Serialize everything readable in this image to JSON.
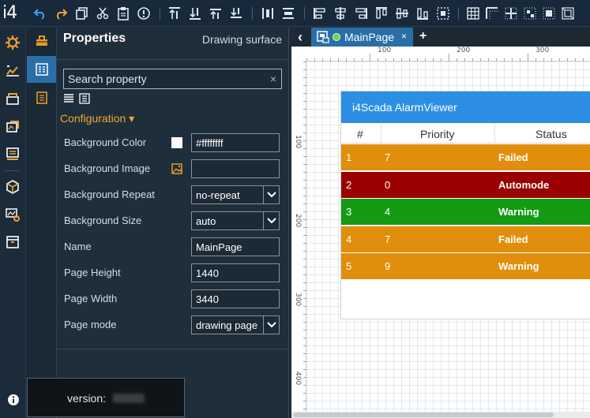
{
  "app": {
    "logo": "i4"
  },
  "toolbar": {
    "icons": [
      "undo-icon",
      "redo-icon",
      "copy-icon",
      "cut-icon",
      "paste-icon",
      "info-icon",
      "bring-front-icon",
      "send-back-icon",
      "bring-forward-icon",
      "send-backward-icon",
      "distribute-horizontal-icon",
      "distribute-vertical-icon",
      "align-left-icon",
      "align-center-icon",
      "align-right-icon",
      "align-top-icon",
      "align-middle-icon",
      "align-bottom-icon",
      "group-icon",
      "grid-icon",
      "grid-corner-icon",
      "grid-center-icon",
      "grid-dots-icon",
      "grid-fill-icon",
      "fit-icon"
    ]
  },
  "leftbar": {
    "icons": [
      "settings-icon",
      "dashboard-icon",
      "layers-icon",
      "page-icon",
      "report-icon",
      "package-icon",
      "network-config-icon",
      "archive-icon"
    ]
  },
  "panelstrip": {
    "icons": [
      "toolbox-icon",
      "properties-icon",
      "notes-icon"
    ]
  },
  "properties": {
    "title": "Properties",
    "subtitle": "Drawing surface",
    "search_placeholder": "Search property",
    "clear_symbol": "×",
    "section_label": "Configuration ▾",
    "rows": [
      {
        "label": "Background Color",
        "value": "#ffffffff",
        "kind": "color"
      },
      {
        "label": "Background Image",
        "value": "",
        "kind": "image"
      },
      {
        "label": "Background Repeat",
        "value": "no-repeat",
        "kind": "select"
      },
      {
        "label": "Background Size",
        "value": "auto",
        "kind": "select"
      },
      {
        "label": "Name",
        "value": "MainPage",
        "kind": "text"
      },
      {
        "label": "Page Height",
        "value": "1440",
        "kind": "text"
      },
      {
        "label": "Page Width",
        "value": "3440",
        "kind": "text"
      },
      {
        "label": "Page mode",
        "value": "drawing page",
        "kind": "select"
      }
    ]
  },
  "version": {
    "label": "version:"
  },
  "tabs": {
    "back_symbol": "‹",
    "active": "MainPage",
    "close_symbol": "×",
    "add_symbol": "+"
  },
  "ruler": {
    "top_labels": [
      "100",
      "200",
      "300"
    ],
    "left_labels": [
      "100",
      "200",
      "300",
      "400"
    ]
  },
  "alarm_viewer": {
    "title": "i4Scada AlarmViewer",
    "columns": [
      "#",
      "Priority",
      "Status"
    ],
    "rows": [
      {
        "num": "1",
        "priority": "7",
        "status": "Failed",
        "color": "#e08e0b"
      },
      {
        "num": "2",
        "priority": "0",
        "status": "Automode",
        "color": "#9b0000"
      },
      {
        "num": "3",
        "priority": "4",
        "status": "Warning",
        "color": "#149a14"
      },
      {
        "num": "4",
        "priority": "7",
        "status": "Failed",
        "color": "#e08e0b"
      },
      {
        "num": "5",
        "priority": "9",
        "status": "Warning",
        "color": "#e08e0b"
      }
    ]
  },
  "colors": {
    "accent": "#2a6ea8",
    "header_blue": "#2d8fe4",
    "orange": "#f0a030"
  }
}
